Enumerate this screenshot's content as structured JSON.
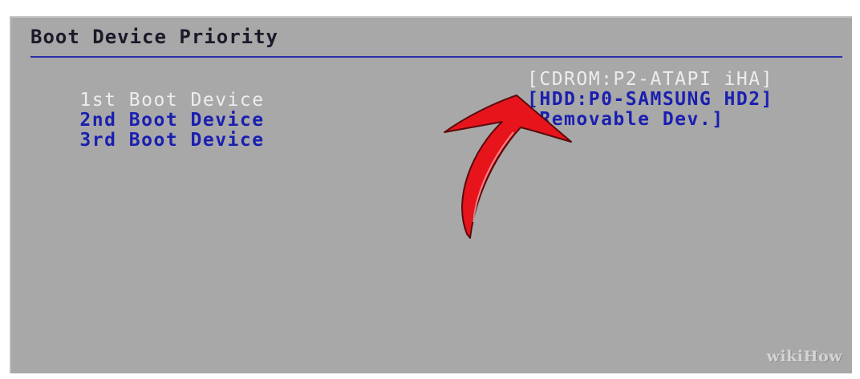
{
  "bios": {
    "title": "Boot Device Priority",
    "boot_devices": [
      {
        "label": "1st Boot Device",
        "value": "[CDROM:P2-ATAPI iHA]"
      },
      {
        "label": "2nd Boot Device",
        "value": "[HDD:P0-SAMSUNG HD2]"
      },
      {
        "label": "3rd Boot Device",
        "value": "[Removable Dev.]"
      }
    ],
    "selected_index": 0
  },
  "watermark": "wikiHow",
  "colors": {
    "background": "#a8a8a8",
    "text_blue": "#1a1fb0",
    "selected_text": "#ededed",
    "rule": "#2b2fa8",
    "arrow": "#e8141c"
  },
  "icons": {
    "annotation": "red-curved-arrow-icon"
  }
}
